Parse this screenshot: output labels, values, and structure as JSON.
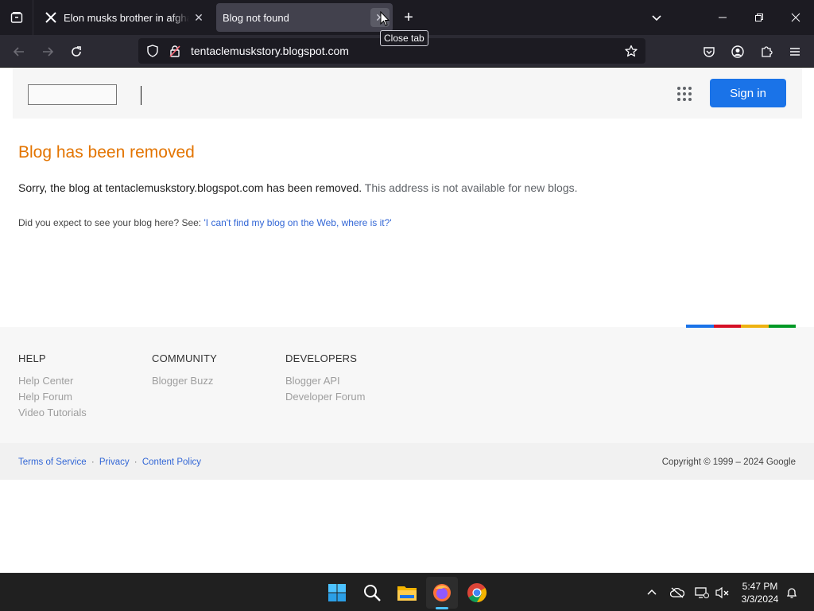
{
  "browser": {
    "tabs": [
      {
        "title": "Elon musks brother in afghanistan",
        "favicon": "x-logo-icon",
        "active": false
      },
      {
        "title": "Blog not found",
        "favicon": "none",
        "active": true
      }
    ],
    "tooltip": "Close tab",
    "url": "tentaclemuskstory.blogspot.com",
    "colors": {
      "tabbar_bg": "#1c1b22",
      "navbar_bg": "#2b2a33",
      "active_tab": "#42414d"
    }
  },
  "header": {
    "signin_label": "Sign in",
    "apps_icon": "apps-grid-icon"
  },
  "main": {
    "title": "Blog has been removed",
    "message_part1": "Sorry, the blog at tentaclemuskstory.blogspot.com has been removed.",
    "message_part2": "This address is not available for new blogs.",
    "expect_prefix": "Did you expect to see your blog here? See:",
    "expect_link": "'I can't find my blog on the Web, where is it?'"
  },
  "footer": {
    "columns": [
      {
        "heading": "HELP",
        "links": [
          "Help Center",
          "Help Forum",
          "Video Tutorials"
        ]
      },
      {
        "heading": "COMMUNITY",
        "links": [
          "Blogger Buzz"
        ]
      },
      {
        "heading": "DEVELOPERS",
        "links": [
          "Blogger API",
          "Developer Forum"
        ]
      }
    ],
    "legal": {
      "terms": "Terms of Service",
      "privacy": "Privacy",
      "content_policy": "Content Policy",
      "separator": "·",
      "copyright": "Copyright © 1999 – 2024 Google"
    },
    "color_bar": [
      "#1a73e8",
      "#d50f25",
      "#eeb211",
      "#009925"
    ]
  },
  "taskbar": {
    "time": "5:47 PM",
    "date": "3/3/2024",
    "apps": [
      "start-icon",
      "search-icon",
      "file-explorer-icon",
      "firefox-icon",
      "chrome-icon"
    ]
  }
}
